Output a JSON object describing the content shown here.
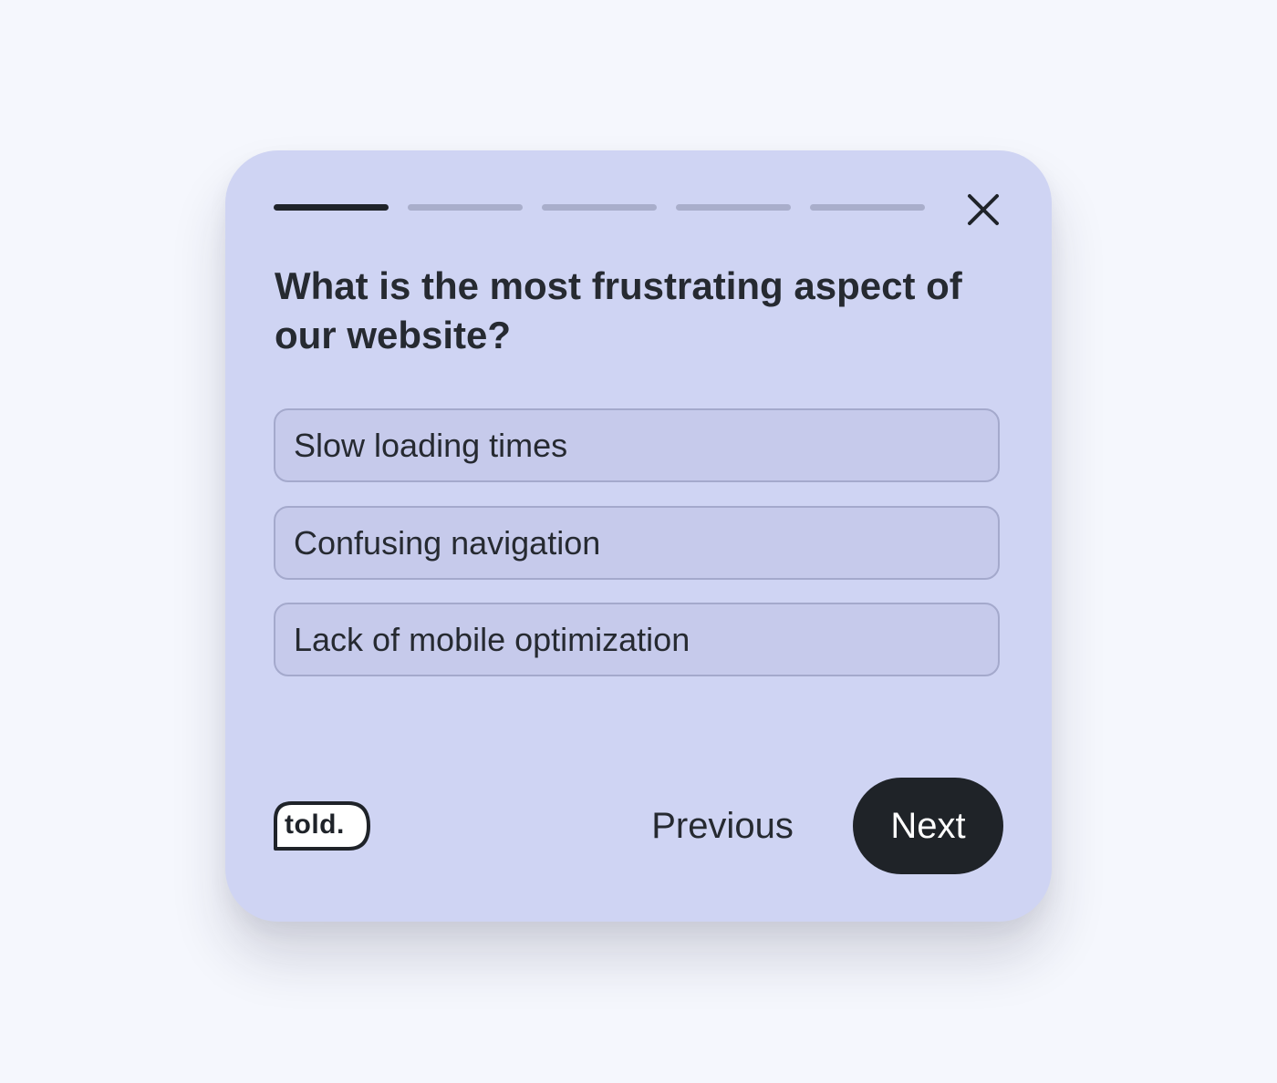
{
  "progress": {
    "total_steps": 5,
    "current_step": 1
  },
  "question": "What is the most frustrating aspect of our website?",
  "options": [
    {
      "label": "Slow loading times"
    },
    {
      "label": "Confusing navigation"
    },
    {
      "label": "Lack of mobile optimization"
    }
  ],
  "footer": {
    "brand": "told.",
    "previous_label": "Previous",
    "next_label": "Next"
  },
  "icons": {
    "close": "close-icon"
  },
  "colors": {
    "page_background": "#f5f7fd",
    "card_background": "#cfd4f3",
    "option_background": "#c6caeb",
    "option_border": "#a4a9cc",
    "text": "#262a31",
    "progress_active": "#1f2329",
    "progress_inactive": "#a9aecb",
    "next_button": "#1f2328"
  }
}
